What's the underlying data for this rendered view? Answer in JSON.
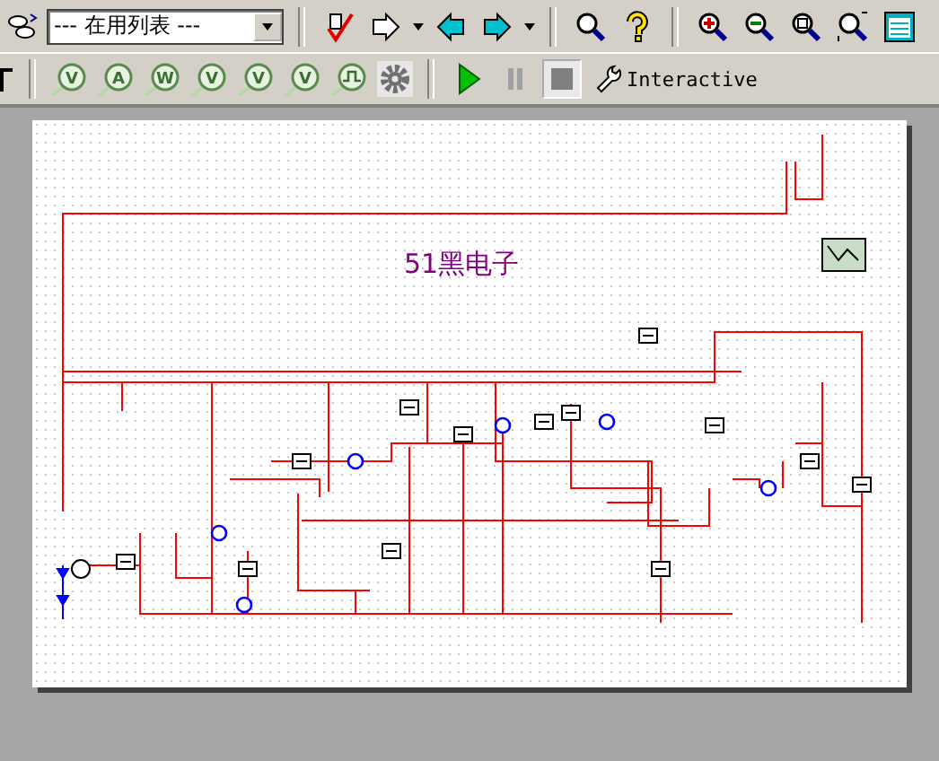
{
  "toolbar": {
    "component_list": {
      "value": "--- 在用列表 ---"
    }
  },
  "instrument_toolbar": {
    "items": [
      {
        "kind": "meter",
        "label": "V"
      },
      {
        "kind": "meter",
        "label": "A"
      },
      {
        "kind": "meter",
        "label": "W"
      },
      {
        "kind": "meter",
        "label": "V"
      },
      {
        "kind": "meter",
        "label": "V"
      },
      {
        "kind": "meter",
        "label": "V"
      },
      {
        "kind": "pulse"
      },
      {
        "kind": "gear"
      }
    ]
  },
  "simulation": {
    "stop_pressed": true,
    "mode": "Interactive"
  },
  "sheet": {
    "title": "51黑电子"
  }
}
